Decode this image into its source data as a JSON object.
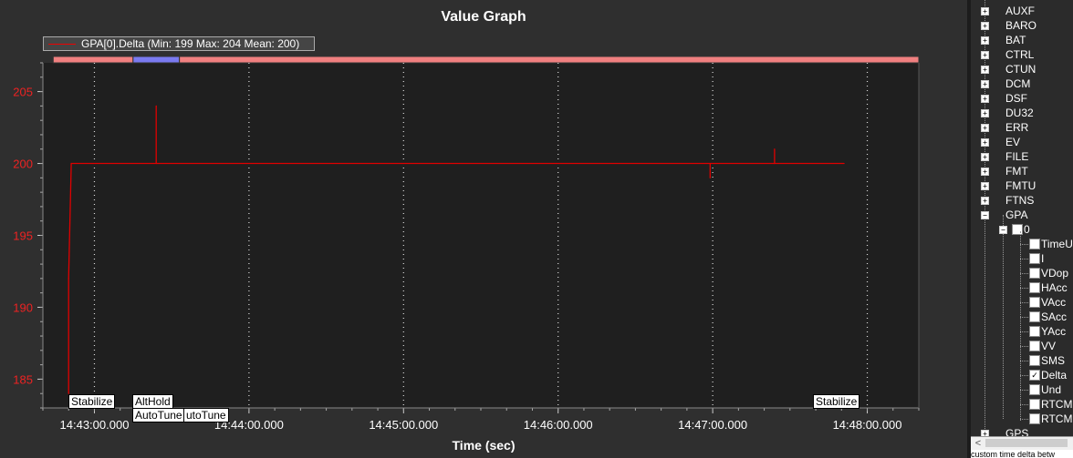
{
  "graph": {
    "title": "Value Graph",
    "legend": "GPA[0].Delta  (Min: 199 Max: 204 Mean: 200)",
    "x_axis_title": "Time (sec)"
  },
  "colors": {
    "series": "#e00000",
    "mode_stabilize": "#f08080",
    "mode_althold": "#7a7af0",
    "plot_bg": "#1f1f1f",
    "panel_bg": "#2f2f2f"
  },
  "mode_labels": [
    "Stabilize",
    "AltHold",
    "AutoTune",
    "utoTune",
    "Stabilize"
  ],
  "mode_bands": [
    {
      "mode": "Stabilize",
      "start": "14:42:44",
      "end": "14:43:15"
    },
    {
      "mode": "AltHold",
      "start": "14:43:15",
      "end": "14:43:33"
    },
    {
      "mode": "Stabilize",
      "start": "14:43:33",
      "end": "14:48:20"
    }
  ],
  "chart_data": {
    "type": "line",
    "title": "Value Graph",
    "xlabel": "Time (sec)",
    "ylabel": "",
    "x_ticks": [
      "14:43:00.000",
      "14:44:00.000",
      "14:45:00.000",
      "14:46:00.000",
      "14:47:00.000",
      "14:48:00.000"
    ],
    "y_ticks": [
      "205",
      "200",
      "195",
      "190",
      "185"
    ],
    "xlim": [
      "14:42:40",
      "14:48:20"
    ],
    "ylim": [
      183,
      207
    ],
    "grid": true,
    "legend_position": "top-left",
    "series": [
      {
        "name": "GPA[0].Delta",
        "points": [
          {
            "x": "14:42:50",
            "y": 184
          },
          {
            "x": "14:42:50",
            "y": 192
          },
          {
            "x": "14:42:51",
            "y": 200
          },
          {
            "x": "14:43:24",
            "y": 200
          },
          {
            "x": "14:43:24",
            "y": 204
          },
          {
            "x": "14:43:24",
            "y": 200
          },
          {
            "x": "14:46:59",
            "y": 200
          },
          {
            "x": "14:46:59",
            "y": 199
          },
          {
            "x": "14:46:59",
            "y": 200
          },
          {
            "x": "14:47:24",
            "y": 200
          },
          {
            "x": "14:47:24",
            "y": 201
          },
          {
            "x": "14:47:24",
            "y": 200
          },
          {
            "x": "14:47:51",
            "y": 200
          }
        ]
      }
    ]
  },
  "tree": {
    "items": [
      {
        "label": "AUXF",
        "expander": "+"
      },
      {
        "label": "BARO",
        "expander": "+"
      },
      {
        "label": "BAT",
        "expander": "+"
      },
      {
        "label": "CTRL",
        "expander": "+"
      },
      {
        "label": "CTUN",
        "expander": "+"
      },
      {
        "label": "DCM",
        "expander": "+"
      },
      {
        "label": "DSF",
        "expander": "+"
      },
      {
        "label": "DU32",
        "expander": "+"
      },
      {
        "label": "ERR",
        "expander": "+"
      },
      {
        "label": "EV",
        "expander": "+"
      },
      {
        "label": "FILE",
        "expander": "+"
      },
      {
        "label": "FMT",
        "expander": "+"
      },
      {
        "label": "FMTU",
        "expander": "+"
      },
      {
        "label": "FTNS",
        "expander": "+"
      },
      {
        "label": "GPA",
        "expander": "−"
      }
    ],
    "instance": {
      "label": "0",
      "expander": "−"
    },
    "fields": [
      {
        "label": "TimeUS",
        "checked": false
      },
      {
        "label": "I",
        "checked": false
      },
      {
        "label": "VDop",
        "checked": false
      },
      {
        "label": "HAcc",
        "checked": false
      },
      {
        "label": "VAcc",
        "checked": false
      },
      {
        "label": "SAcc",
        "checked": false
      },
      {
        "label": "YAcc",
        "checked": false
      },
      {
        "label": "VV",
        "checked": false
      },
      {
        "label": "SMS",
        "checked": false
      },
      {
        "label": "Delta",
        "checked": true
      },
      {
        "label": "Und",
        "checked": false
      },
      {
        "label": "RTCMF",
        "checked": false
      },
      {
        "label": "RTCMF",
        "checked": false
      }
    ],
    "after": {
      "label": "GPS",
      "expander": "+"
    }
  },
  "status_text": "custom time delta betw"
}
